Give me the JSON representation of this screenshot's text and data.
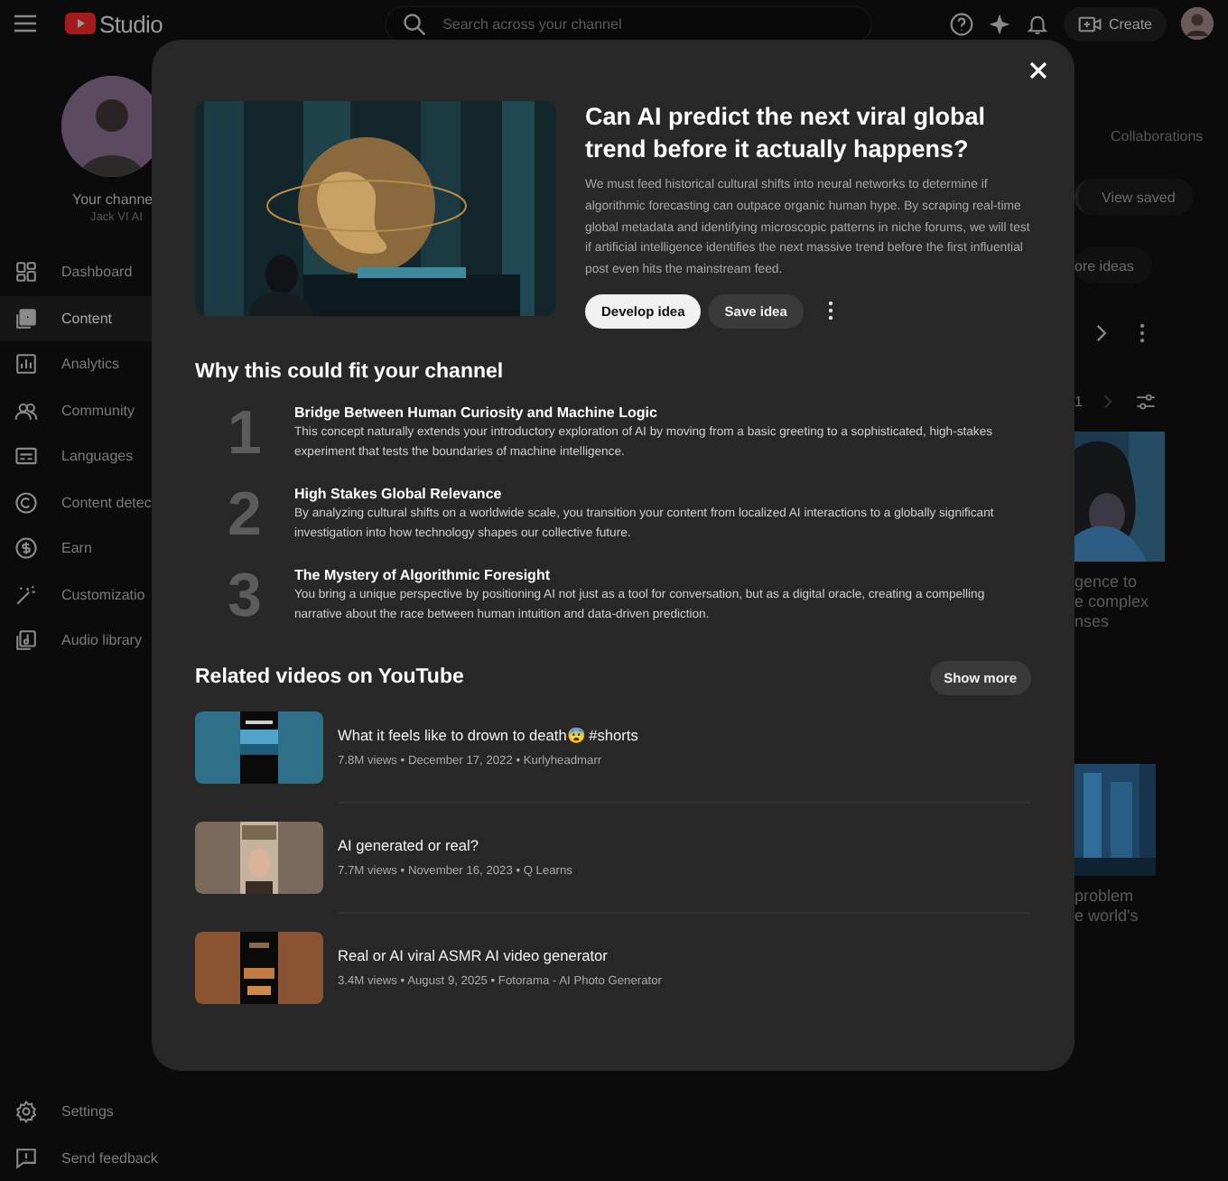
{
  "topbar": {
    "logo": "Studio",
    "search": {
      "placeholder": "Search across your channel"
    },
    "create_button": "Create"
  },
  "sidebar": {
    "channel_title": "Your channe",
    "channel_name": "Jack VI AI",
    "items": [
      {
        "label": "Dashboard",
        "kind": "dashboard",
        "selected": false
      },
      {
        "label": "Content",
        "kind": "content",
        "selected": true
      },
      {
        "label": "Analytics",
        "kind": "analytics",
        "selected": false
      },
      {
        "label": "Community",
        "kind": "community",
        "selected": false
      },
      {
        "label": "Languages",
        "kind": "languages",
        "selected": false
      },
      {
        "label": "Content detec",
        "kind": "copyright",
        "selected": false
      },
      {
        "label": "Earn",
        "kind": "earn",
        "selected": false
      },
      {
        "label": "Customizatio",
        "kind": "customization",
        "selected": false
      },
      {
        "label": "Audio library",
        "kind": "audio",
        "selected": false
      }
    ],
    "footer": [
      {
        "label": "Settings",
        "kind": "settings"
      },
      {
        "label": "Send feedback",
        "kind": "feedback"
      }
    ]
  },
  "background": {
    "tab": "Collaborations",
    "view_saved": "View saved",
    "more_ideas": "ore ideas",
    "page": "1",
    "cards": [
      {
        "title_lines": [
          "gence to",
          "e complex",
          "nses"
        ]
      },
      {
        "title_lines": [
          "problem",
          "e world's"
        ]
      }
    ]
  },
  "dialog": {
    "title": "Can AI predict the next viral global trend before it actually happens?",
    "description": "We must feed historical cultural shifts into neural networks to determine if algorithmic forecasting can outpace organic human hype. By scraping real-time global metadata and identifying microscopic patterns in niche forums, we will test if artificial intelligence identifies the next massive trend before the first influential post even hits the mainstream feed.",
    "primary_button": "Develop idea",
    "secondary_button": "Save idea",
    "reasons_title": "Why this could fit your channel",
    "reasons": [
      {
        "number": "1",
        "title": "Bridge Between Human Curiosity and Machine Logic",
        "text": "This concept naturally extends your introductory exploration of AI by moving from a basic greeting to a sophisticated, high-stakes experiment that tests the boundaries of machine intelligence."
      },
      {
        "number": "2",
        "title": "High Stakes Global Relevance",
        "text": "By analyzing cultural shifts on a worldwide scale, you transition your content from localized AI interactions to a globally significant investigation into how technology shapes our collective future."
      },
      {
        "number": "3",
        "title": "The Mystery of Algorithmic Foresight",
        "text": "You bring a unique perspective by positioning AI not just as a tool for conversation, but as a digital oracle, creating a compelling narrative about the race between human intuition and data-driven prediction."
      }
    ],
    "related_title": "Related videos on YouTube",
    "show_more": "Show more",
    "videos": [
      {
        "title": "What it feels like to drown to death😨 #shorts",
        "meta": "7.8M views • December 17, 2022 • Kurlyheadmarr"
      },
      {
        "title": "AI generated or real?",
        "meta": "7.7M views • November 16, 2023 • Q Learns"
      },
      {
        "title": "Real or AI viral ASMR AI video generator",
        "meta": "3.4M views • August 9, 2025 • Fotorama - AI Photo Generator"
      }
    ]
  }
}
